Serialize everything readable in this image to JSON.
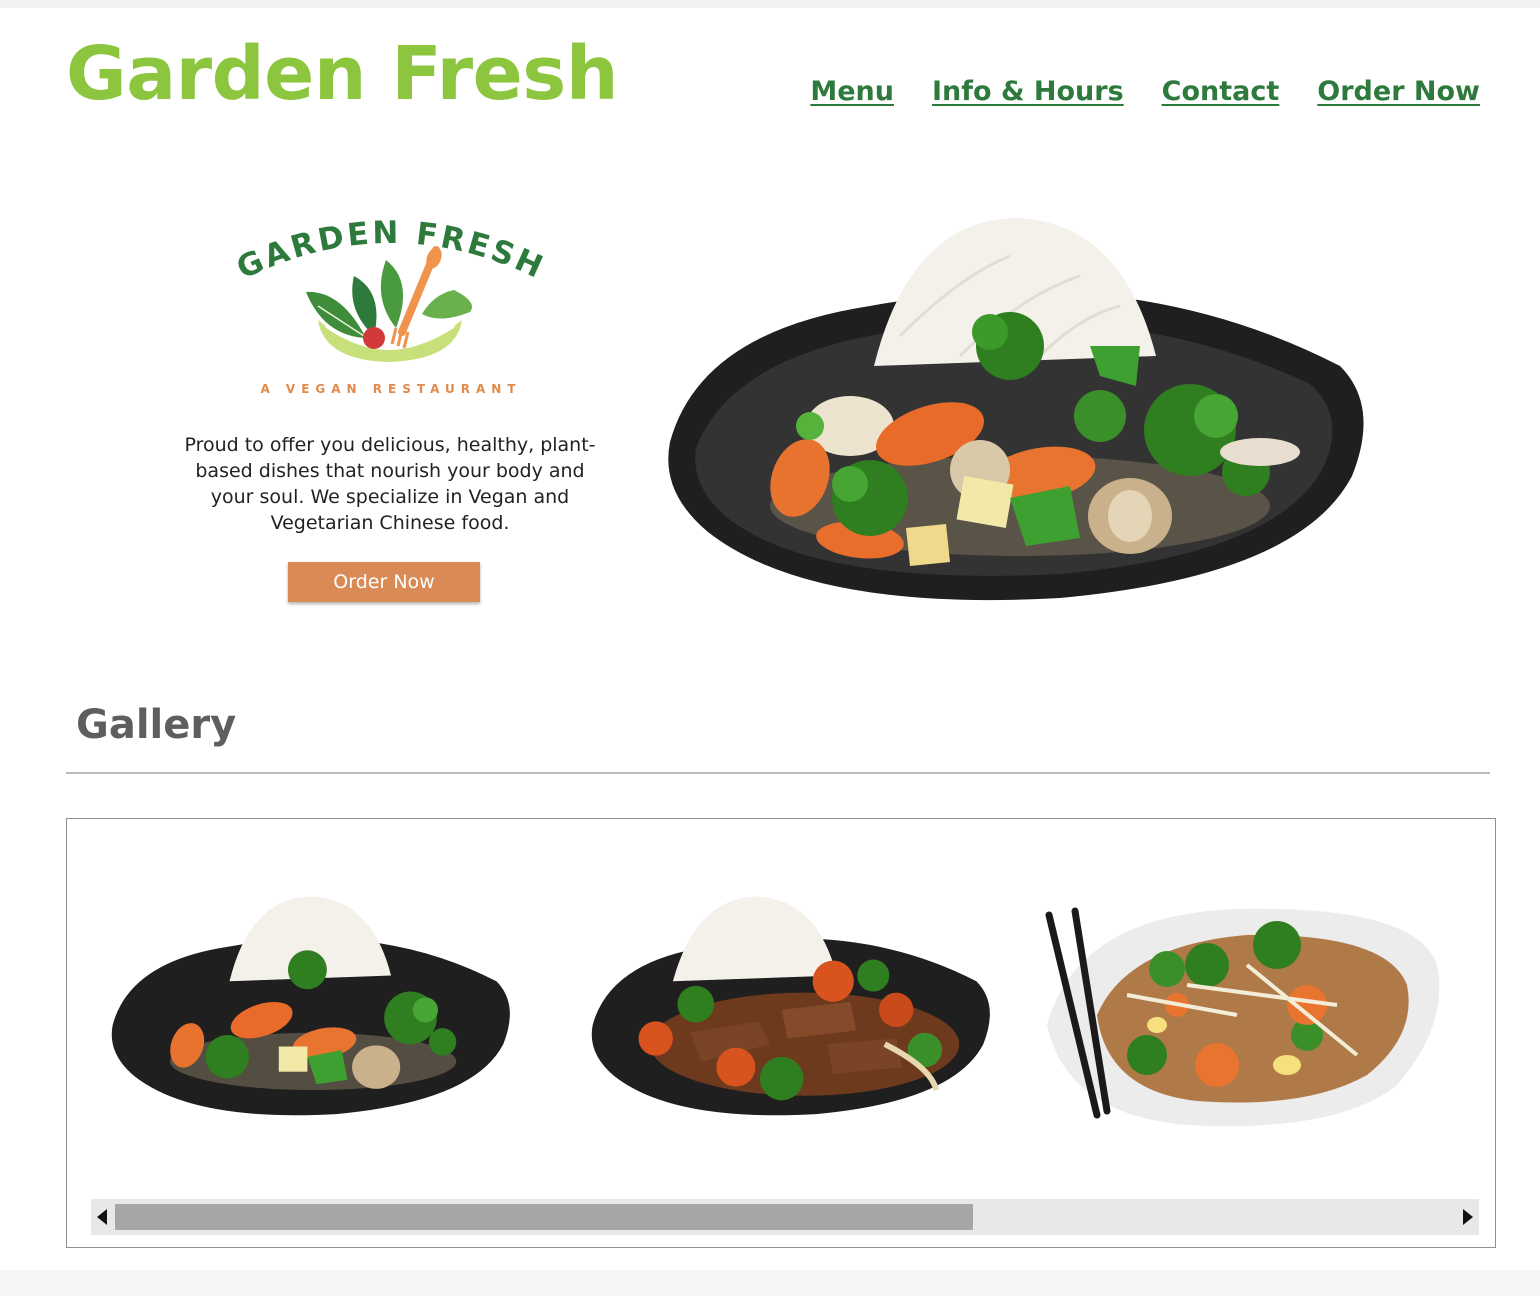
{
  "header": {
    "site_title": "Garden Fresh",
    "nav": [
      {
        "label": "Menu"
      },
      {
        "label": "Info & Hours"
      },
      {
        "label": "Contact"
      },
      {
        "label": "Order Now"
      }
    ]
  },
  "logo": {
    "wordmark": "GARDEN FRESH",
    "tagline": "A VEGAN RESTAURANT"
  },
  "intro": {
    "text": "Proud to offer you delicious, healthy, plant-based  dishes that nourish your body and your soul. We specialize in Vegan and Vegetarian Chinese food.",
    "button_label": "Order Now"
  },
  "gallery": {
    "title": "Gallery",
    "scroll_position_fraction": 0.64
  },
  "colors": {
    "brand_green": "#8cc63f",
    "nav_green": "#2e7a3d",
    "order_orange": "#d98a55",
    "heading_gray": "#5e5e5e"
  }
}
